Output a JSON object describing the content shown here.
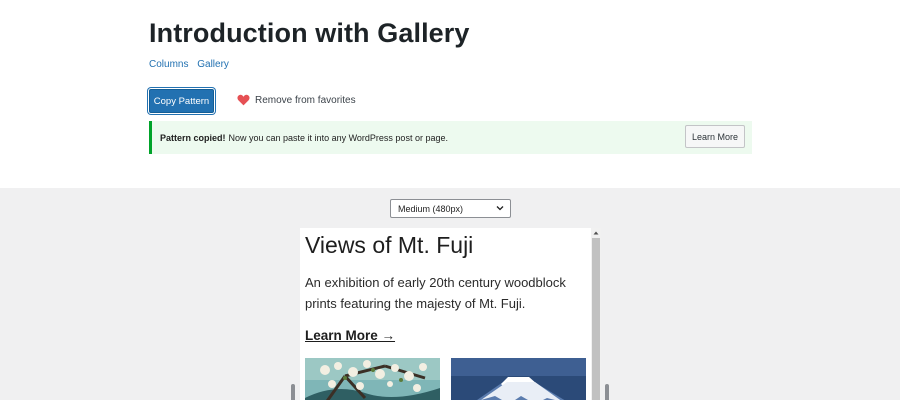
{
  "header": {
    "title": "Introduction with Gallery",
    "categories": [
      "Columns",
      "Gallery"
    ]
  },
  "actions": {
    "copy_label": "Copy Pattern",
    "favorite_label": "Remove from favorites"
  },
  "notice": {
    "strong": "Pattern copied!",
    "text": "Now you can paste it into any WordPress post or page.",
    "button": "Learn More"
  },
  "preview": {
    "size_selected": "Medium (480px)",
    "title": "Views of Mt. Fuji",
    "description": "An exhibition of early 20th century woodblock prints featuring the majesty of Mt. Fuji.",
    "link": "Learn More →"
  },
  "colors": {
    "accent": "#2271b1",
    "success": "#00a32a",
    "heart": "#e65054"
  },
  "icons": {
    "favorite": "heart-icon",
    "select": "chevron-down-icon"
  }
}
